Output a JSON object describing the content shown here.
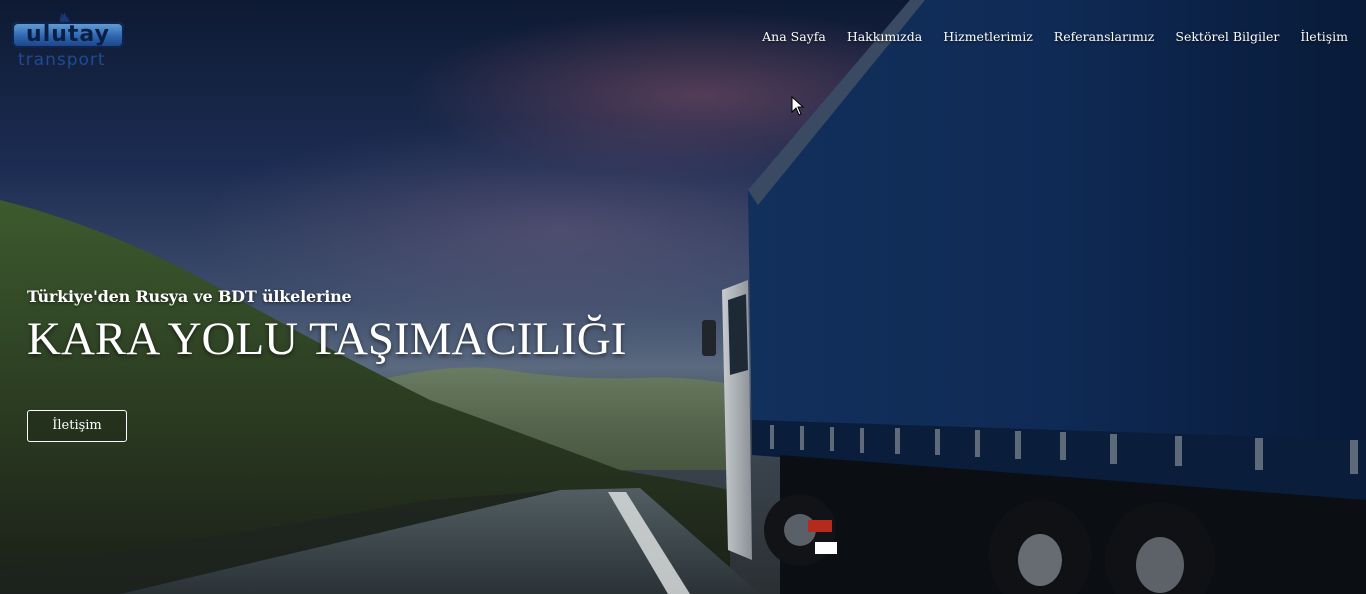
{
  "logo": {
    "wordmark": "ulutay",
    "subtitle": "transport",
    "icon": "horse-icon"
  },
  "nav": {
    "items": [
      {
        "label": "Ana Sayfa"
      },
      {
        "label": "Hakkımızda"
      },
      {
        "label": "Hizmetlerimiz"
      },
      {
        "label": "Referanslarımız"
      },
      {
        "label": "Sektörel Bilgiler"
      },
      {
        "label": "İletişim"
      }
    ]
  },
  "hero": {
    "subheading": "Türkiye'den Rusya ve BDT ülkelerine",
    "heading": "KARA YOLU TAŞIMACILIĞI",
    "cta_label": "İletişim"
  },
  "colors": {
    "text": "#ffffff",
    "sky_top": "#0e1a33",
    "trailer_blue": "#0f2a55",
    "logo_blue": "#2e66b0"
  }
}
